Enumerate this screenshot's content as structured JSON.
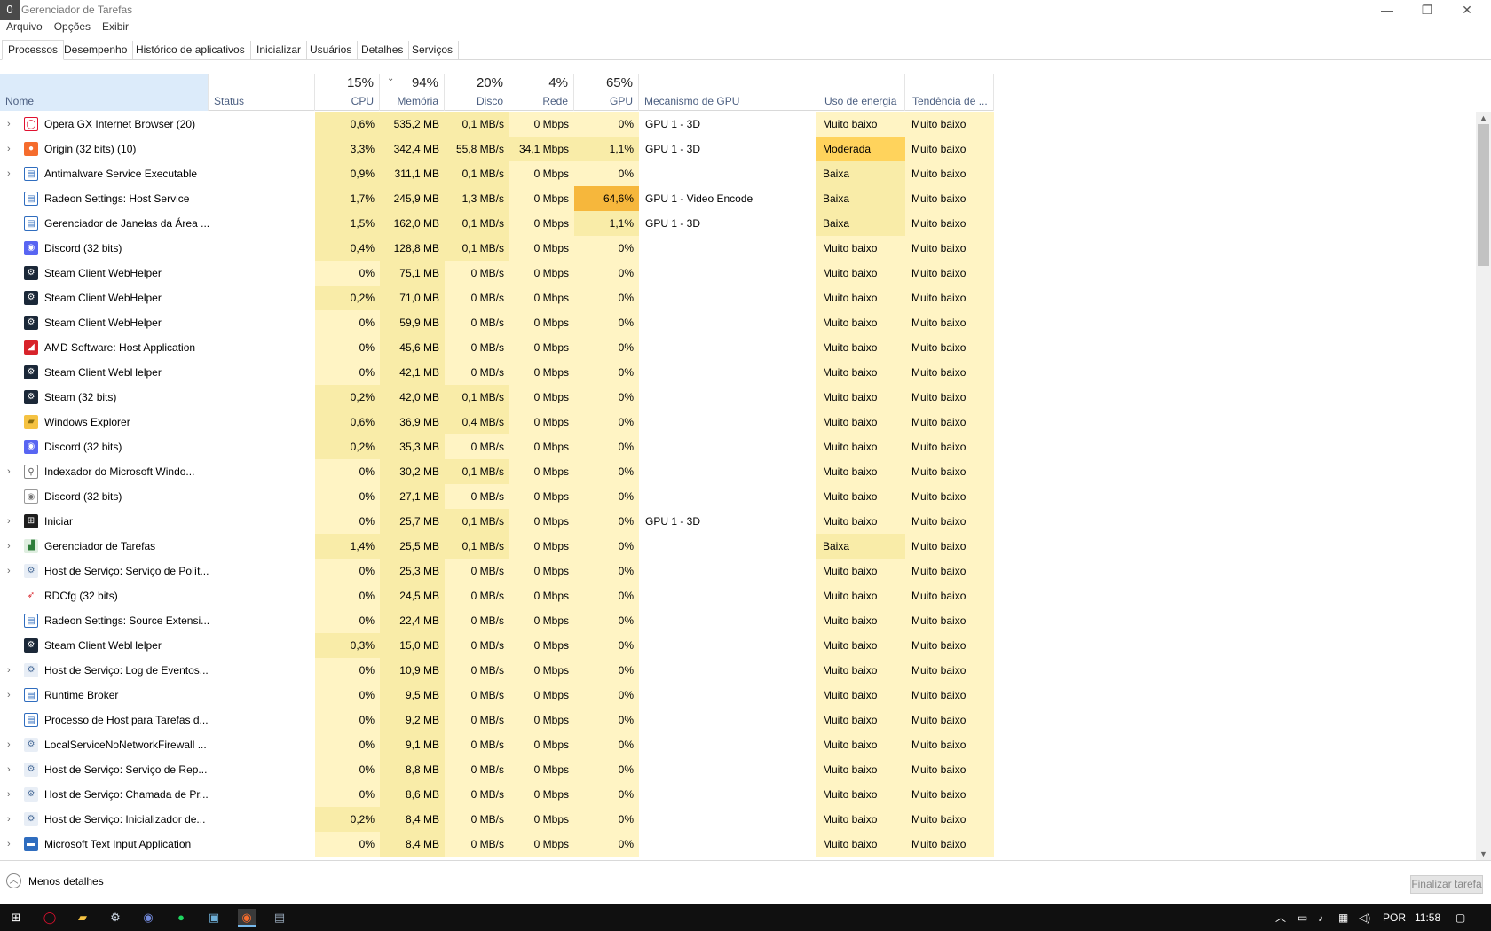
{
  "window": {
    "title": "Gerenciador de Tarefas",
    "app_icon": "0"
  },
  "window_controls": {
    "minimize": "—",
    "restore": "❐",
    "close": "✕"
  },
  "menu": [
    "Arquivo",
    "Opções",
    "Exibir"
  ],
  "tabs": [
    "Processos",
    "Desempenho",
    "Histórico de aplicativos",
    "Inicializar",
    "Usuários",
    "Detalhes",
    "Serviços"
  ],
  "columns": {
    "name": "Nome",
    "status": "Status",
    "cpu": {
      "pct": "15%",
      "label": "CPU"
    },
    "mem": {
      "pct": "94%",
      "label": "Memória"
    },
    "disk": {
      "pct": "20%",
      "label": "Disco"
    },
    "net": {
      "pct": "4%",
      "label": "Rede"
    },
    "gpu": {
      "pct": "65%",
      "label": "GPU"
    },
    "gpu_engine": "Mecanismo de GPU",
    "power": "Uso de energia",
    "power_trend": "Tendência de ..."
  },
  "sort_indicator": "⌄",
  "colors": {
    "light": "#fff4c4",
    "mid": "#f9eca8",
    "strong": "#ffd35c",
    "gpu_hot": "#f6b73c"
  },
  "rows": [
    {
      "exp": true,
      "icon": "opera-gx-icon",
      "name": "Opera GX Internet Browser (20)",
      "cpu": "0,6%",
      "mem": "535,2 MB",
      "disk": "0,1 MB/s",
      "net": "0 Mbps",
      "gpu": "0%",
      "eng": "GPU 1 - 3D",
      "pow": "Muito baixo",
      "trend": "Muito baixo"
    },
    {
      "exp": true,
      "icon": "origin-icon",
      "name": "Origin (32 bits) (10)",
      "cpu": "3,3%",
      "mem": "342,4 MB",
      "disk": "55,8 MB/s",
      "net": "34,1 Mbps",
      "gpu": "1,1%",
      "eng": "GPU 1 - 3D",
      "pow": "Moderada",
      "trend": "Muito baixo",
      "powhot": true
    },
    {
      "exp": true,
      "icon": "app-window-icon",
      "name": "Antimalware Service Executable",
      "cpu": "0,9%",
      "mem": "311,1 MB",
      "disk": "0,1 MB/s",
      "net": "0 Mbps",
      "gpu": "0%",
      "eng": "",
      "pow": "Baixa",
      "trend": "Muito baixo"
    },
    {
      "exp": false,
      "icon": "app-window-icon",
      "name": "Radeon Settings: Host Service",
      "cpu": "1,7%",
      "mem": "245,9 MB",
      "disk": "1,3 MB/s",
      "net": "0 Mbps",
      "gpu": "64,6%",
      "eng": "GPU 1 - Video Encode",
      "pow": "Baixa",
      "trend": "Muito baixo",
      "gpuhot": true
    },
    {
      "exp": false,
      "icon": "app-window-icon",
      "name": "Gerenciador de Janelas da Área ...",
      "cpu": "1,5%",
      "mem": "162,0 MB",
      "disk": "0,1 MB/s",
      "net": "0 Mbps",
      "gpu": "1,1%",
      "eng": "GPU 1 - 3D",
      "pow": "Baixa",
      "trend": "Muito baixo"
    },
    {
      "exp": false,
      "icon": "discord-icon",
      "name": "Discord (32 bits)",
      "cpu": "0,4%",
      "mem": "128,8 MB",
      "disk": "0,1 MB/s",
      "net": "0 Mbps",
      "gpu": "0%",
      "eng": "",
      "pow": "Muito baixo",
      "trend": "Muito baixo"
    },
    {
      "exp": false,
      "icon": "steam-icon",
      "name": "Steam Client WebHelper",
      "cpu": "0%",
      "mem": "75,1 MB",
      "disk": "0 MB/s",
      "net": "0 Mbps",
      "gpu": "0%",
      "eng": "",
      "pow": "Muito baixo",
      "trend": "Muito baixo"
    },
    {
      "exp": false,
      "icon": "steam-icon",
      "name": "Steam Client WebHelper",
      "cpu": "0,2%",
      "mem": "71,0 MB",
      "disk": "0 MB/s",
      "net": "0 Mbps",
      "gpu": "0%",
      "eng": "",
      "pow": "Muito baixo",
      "trend": "Muito baixo"
    },
    {
      "exp": false,
      "icon": "steam-icon",
      "name": "Steam Client WebHelper",
      "cpu": "0%",
      "mem": "59,9 MB",
      "disk": "0 MB/s",
      "net": "0 Mbps",
      "gpu": "0%",
      "eng": "",
      "pow": "Muito baixo",
      "trend": "Muito baixo"
    },
    {
      "exp": false,
      "icon": "amd-icon",
      "name": "AMD Software: Host Application",
      "cpu": "0%",
      "mem": "45,6 MB",
      "disk": "0 MB/s",
      "net": "0 Mbps",
      "gpu": "0%",
      "eng": "",
      "pow": "Muito baixo",
      "trend": "Muito baixo"
    },
    {
      "exp": false,
      "icon": "steam-icon",
      "name": "Steam Client WebHelper",
      "cpu": "0%",
      "mem": "42,1 MB",
      "disk": "0 MB/s",
      "net": "0 Mbps",
      "gpu": "0%",
      "eng": "",
      "pow": "Muito baixo",
      "trend": "Muito baixo"
    },
    {
      "exp": false,
      "icon": "steam-icon",
      "name": "Steam (32 bits)",
      "cpu": "0,2%",
      "mem": "42,0 MB",
      "disk": "0,1 MB/s",
      "net": "0 Mbps",
      "gpu": "0%",
      "eng": "",
      "pow": "Muito baixo",
      "trend": "Muito baixo"
    },
    {
      "exp": false,
      "icon": "folder-icon",
      "name": "Windows Explorer",
      "cpu": "0,6%",
      "mem": "36,9 MB",
      "disk": "0,4 MB/s",
      "net": "0 Mbps",
      "gpu": "0%",
      "eng": "",
      "pow": "Muito baixo",
      "trend": "Muito baixo"
    },
    {
      "exp": false,
      "icon": "discord-icon",
      "name": "Discord (32 bits)",
      "cpu": "0,2%",
      "mem": "35,3 MB",
      "disk": "0 MB/s",
      "net": "0 Mbps",
      "gpu": "0%",
      "eng": "",
      "pow": "Muito baixo",
      "trend": "Muito baixo"
    },
    {
      "exp": true,
      "icon": "indexer-icon",
      "name": "Indexador do Microsoft Windo...",
      "cpu": "0%",
      "mem": "30,2 MB",
      "disk": "0,1 MB/s",
      "net": "0 Mbps",
      "gpu": "0%",
      "eng": "",
      "pow": "Muito baixo",
      "trend": "Muito baixo"
    },
    {
      "exp": false,
      "icon": "discord-gray-icon",
      "name": "Discord (32 bits)",
      "cpu": "0%",
      "mem": "27,1 MB",
      "disk": "0 MB/s",
      "net": "0 Mbps",
      "gpu": "0%",
      "eng": "",
      "pow": "Muito baixo",
      "trend": "Muito baixo"
    },
    {
      "exp": true,
      "icon": "start-icon",
      "name": "Iniciar",
      "cpu": "0%",
      "mem": "25,7 MB",
      "disk": "0,1 MB/s",
      "net": "0 Mbps",
      "gpu": "0%",
      "eng": "GPU 1 - 3D",
      "pow": "Muito baixo",
      "trend": "Muito baixo"
    },
    {
      "exp": true,
      "icon": "taskmgr-icon",
      "name": "Gerenciador de Tarefas",
      "cpu": "1,4%",
      "mem": "25,5 MB",
      "disk": "0,1 MB/s",
      "net": "0 Mbps",
      "gpu": "0%",
      "eng": "",
      "pow": "Baixa",
      "trend": "Muito baixo"
    },
    {
      "exp": true,
      "icon": "service-gear-icon",
      "name": "Host de Serviço: Serviço de Polít...",
      "cpu": "0%",
      "mem": "25,3 MB",
      "disk": "0 MB/s",
      "net": "0 Mbps",
      "gpu": "0%",
      "eng": "",
      "pow": "Muito baixo",
      "trend": "Muito baixo"
    },
    {
      "exp": false,
      "icon": "radeon-icon",
      "name": "RDCfg (32 bits)",
      "cpu": "0%",
      "mem": "24,5 MB",
      "disk": "0 MB/s",
      "net": "0 Mbps",
      "gpu": "0%",
      "eng": "",
      "pow": "Muito baixo",
      "trend": "Muito baixo"
    },
    {
      "exp": false,
      "icon": "app-window-icon",
      "name": "Radeon Settings: Source Extensi...",
      "cpu": "0%",
      "mem": "22,4 MB",
      "disk": "0 MB/s",
      "net": "0 Mbps",
      "gpu": "0%",
      "eng": "",
      "pow": "Muito baixo",
      "trend": "Muito baixo"
    },
    {
      "exp": false,
      "icon": "steam-icon",
      "name": "Steam Client WebHelper",
      "cpu": "0,3%",
      "mem": "15,0 MB",
      "disk": "0 MB/s",
      "net": "0 Mbps",
      "gpu": "0%",
      "eng": "",
      "pow": "Muito baixo",
      "trend": "Muito baixo"
    },
    {
      "exp": true,
      "icon": "service-gear-icon",
      "name": "Host de Serviço: Log de Eventos...",
      "cpu": "0%",
      "mem": "10,9 MB",
      "disk": "0 MB/s",
      "net": "0 Mbps",
      "gpu": "0%",
      "eng": "",
      "pow": "Muito baixo",
      "trend": "Muito baixo"
    },
    {
      "exp": true,
      "icon": "app-window-icon",
      "name": "Runtime Broker",
      "cpu": "0%",
      "mem": "9,5 MB",
      "disk": "0 MB/s",
      "net": "0 Mbps",
      "gpu": "0%",
      "eng": "",
      "pow": "Muito baixo",
      "trend": "Muito baixo"
    },
    {
      "exp": false,
      "icon": "app-window-icon",
      "name": "Processo de Host para Tarefas d...",
      "cpu": "0%",
      "mem": "9,2 MB",
      "disk": "0 MB/s",
      "net": "0 Mbps",
      "gpu": "0%",
      "eng": "",
      "pow": "Muito baixo",
      "trend": "Muito baixo"
    },
    {
      "exp": true,
      "icon": "service-gear-icon",
      "name": "LocalServiceNoNetworkFirewall ...",
      "cpu": "0%",
      "mem": "9,1 MB",
      "disk": "0 MB/s",
      "net": "0 Mbps",
      "gpu": "0%",
      "eng": "",
      "pow": "Muito baixo",
      "trend": "Muito baixo"
    },
    {
      "exp": true,
      "icon": "service-gear-icon",
      "name": "Host de Serviço: Serviço de Rep...",
      "cpu": "0%",
      "mem": "8,8 MB",
      "disk": "0 MB/s",
      "net": "0 Mbps",
      "gpu": "0%",
      "eng": "",
      "pow": "Muito baixo",
      "trend": "Muito baixo"
    },
    {
      "exp": true,
      "icon": "service-gear-icon",
      "name": "Host de Serviço: Chamada de Pr...",
      "cpu": "0%",
      "mem": "8,6 MB",
      "disk": "0 MB/s",
      "net": "0 Mbps",
      "gpu": "0%",
      "eng": "",
      "pow": "Muito baixo",
      "trend": "Muito baixo"
    },
    {
      "exp": true,
      "icon": "service-gear-icon",
      "name": "Host de Serviço: Inicializador de...",
      "cpu": "0,2%",
      "mem": "8,4 MB",
      "disk": "0 MB/s",
      "net": "0 Mbps",
      "gpu": "0%",
      "eng": "",
      "pow": "Muito baixo",
      "trend": "Muito baixo"
    },
    {
      "exp": true,
      "icon": "text-input-icon",
      "name": "Microsoft Text Input Application",
      "cpu": "0%",
      "mem": "8,4 MB",
      "disk": "0 MB/s",
      "net": "0 Mbps",
      "gpu": "0%",
      "eng": "",
      "pow": "Muito baixo",
      "trend": "Muito baixo"
    }
  ],
  "footer": {
    "less_details": "Menos detalhes",
    "end_task": "Finalizar tarefa"
  },
  "taskbar": {
    "icons": [
      "windows-start-icon",
      "opera-gx-icon",
      "file-explorer-icon",
      "steam-icon",
      "discord-icon",
      "spotify-icon",
      "app-icon",
      "origin-icon",
      "taskmgr-icon"
    ],
    "language": "POR",
    "time": "11:58"
  }
}
